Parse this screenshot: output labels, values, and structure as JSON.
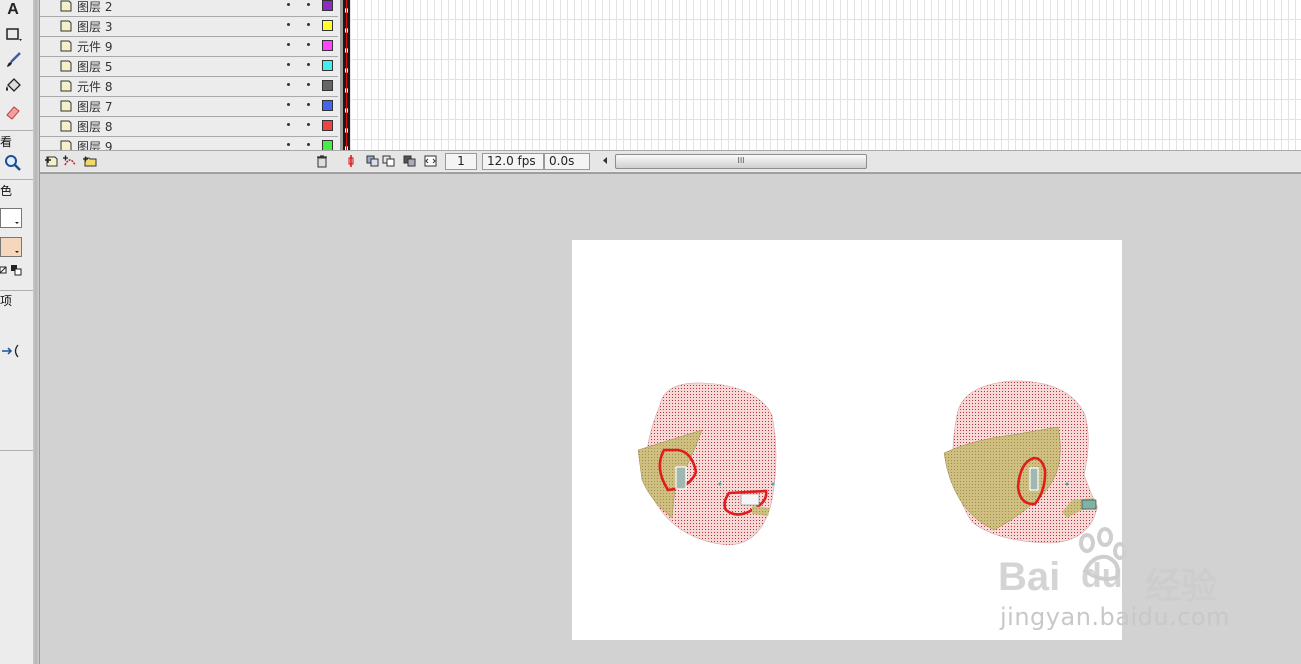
{
  "tools_panel": {
    "section_view": "看",
    "section_color": "色",
    "section_options": "项",
    "text_tool_label": "A",
    "fill_color": "#f5d7bd",
    "stroke_color": "#ffffff"
  },
  "timeline": {
    "layers": [
      {
        "name": "图层 2",
        "color": "#8a2ec2"
      },
      {
        "name": "图层 3",
        "color": "#ffff33"
      },
      {
        "name": "元件 9",
        "color": "#ff44ff"
      },
      {
        "name": "图层 5",
        "color": "#44eeee"
      },
      {
        "name": "元件 8",
        "color": "#666666"
      },
      {
        "name": "图层 7",
        "color": "#4466ee"
      },
      {
        "name": "图层 8",
        "color": "#ee4444"
      },
      {
        "name": "图层 9",
        "color": "#44ee44"
      }
    ],
    "footer": {
      "current_frame": "1",
      "frame_rate": "12.0 fps",
      "elapsed_time": "0.0s",
      "scroll_grip": "III"
    }
  },
  "watermark": {
    "brand": "Bai",
    "brand_du": "du",
    "brand_cn": "经验",
    "url": "jingyan.baidu.com"
  }
}
